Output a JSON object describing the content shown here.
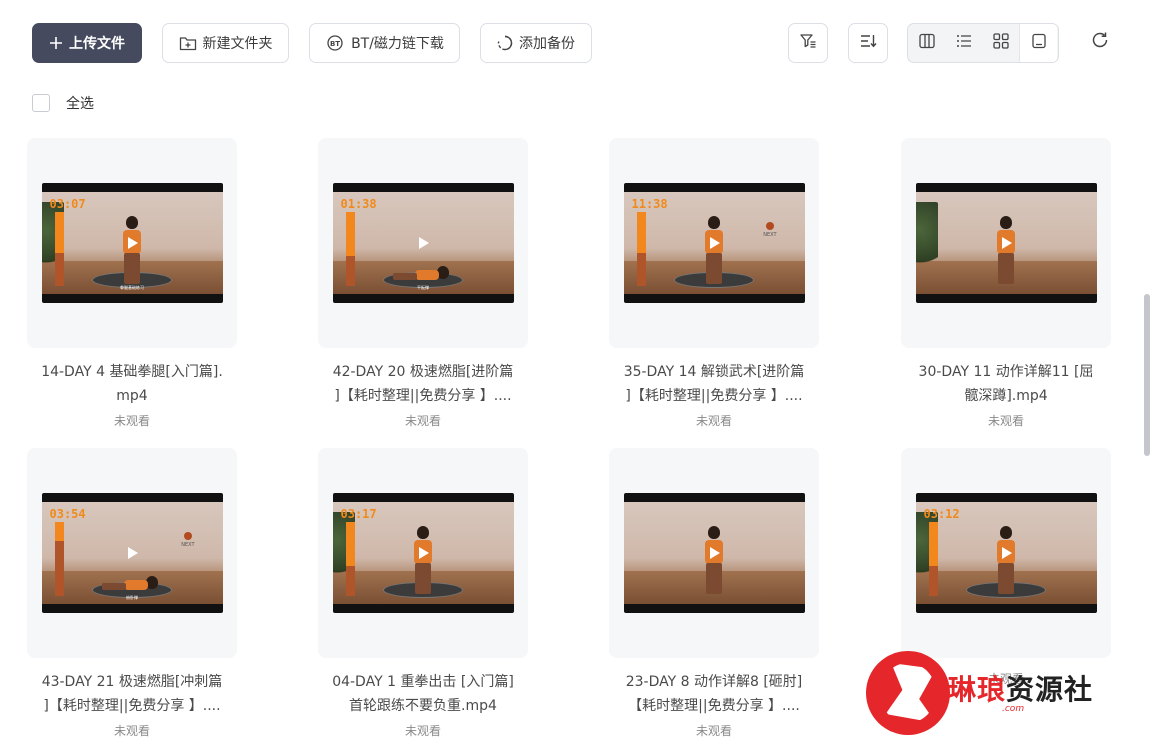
{
  "toolbar": {
    "upload_label": "上传文件",
    "new_folder_label": "新建文件夹",
    "bt_label": "BT/磁力链下载",
    "backup_label": "添加备份"
  },
  "select_all_label": "全选",
  "files": [
    {
      "name_line1": "14-DAY 4 基础拳腿[入门篇].",
      "name_line2": "mp4",
      "status": "未观看",
      "timer": "03:07",
      "caption": "拳腿基础练习",
      "fill": 0.55,
      "next": false,
      "plant": true,
      "scene": "standing"
    },
    {
      "name_line1": "42-DAY 20 极速燃脂[进阶篇",
      "name_line2": "]【耗时整理||免费分享 】....",
      "status": "未观看",
      "timer": "01:38",
      "caption": "平板撑",
      "fill": 0.6,
      "next": false,
      "plant": false,
      "scene": "floor"
    },
    {
      "name_line1": "35-DAY 14 解锁武术[进阶篇",
      "name_line2": "]【耗时整理||免费分享 】....",
      "status": "未观看",
      "timer": "11:38",
      "caption": "",
      "fill": 0.55,
      "next": true,
      "next_label": "NEXT",
      "plant": false,
      "scene": "standing"
    },
    {
      "name_line1": "30-DAY 11 动作详解11 [屈",
      "name_line2": "髋深蹲].mp4",
      "status": "未观看",
      "timer": "",
      "caption": "",
      "fill": 0,
      "next": false,
      "plant": true,
      "scene": "standing"
    },
    {
      "name_line1": "43-DAY 21 极速燃脂[冲刺篇",
      "name_line2": "]【耗时整理||免费分享 】....",
      "status": "未观看",
      "timer": "03:54",
      "caption": "俯卧撑",
      "fill": 0.25,
      "next": true,
      "next_label": "NEXT",
      "plant": false,
      "scene": "floor"
    },
    {
      "name_line1": "04-DAY 1 重拳出击 [入门篇]",
      "name_line2": "首轮跟练不要负重.mp4",
      "status": "未观看",
      "timer": "03:17",
      "caption": "",
      "fill": 0.6,
      "next": false,
      "plant": true,
      "scene": "standing"
    },
    {
      "name_line1": "23-DAY 8 动作详解8 [砸肘]",
      "name_line2": "【耗时整理||免费分享 】....",
      "status": "未观看",
      "timer": "",
      "caption": "",
      "fill": 0,
      "next": false,
      "plant": false,
      "scene": "standing"
    },
    {
      "name_line1": "",
      "name_line2": "",
      "status": "未观看",
      "timer": "03:12",
      "caption": "",
      "fill": 0.6,
      "next": false,
      "plant": true,
      "scene": "standing"
    }
  ],
  "watermark": {
    "text_red": "琳琅",
    "text_dark": "资源社",
    "sub": ".com"
  },
  "colors": {
    "primary": "#454a5e",
    "accent_orange": "#f2871e",
    "watermark_red": "#e5262a"
  }
}
